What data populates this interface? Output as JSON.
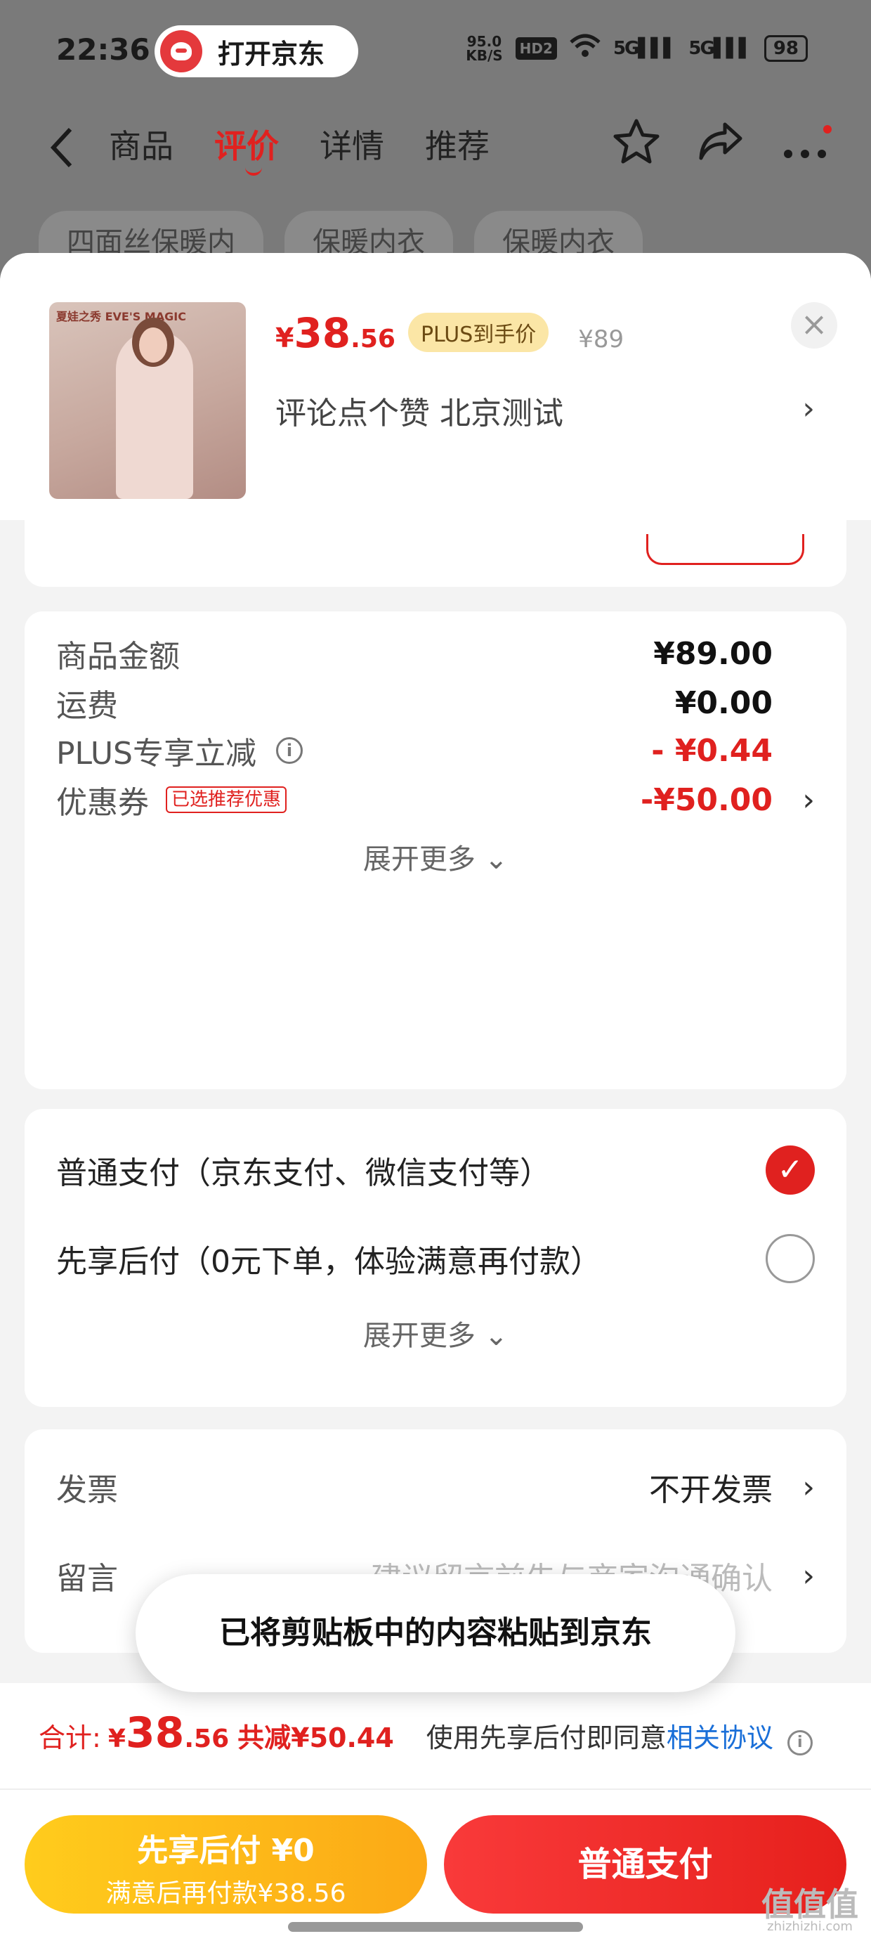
{
  "status_bar": {
    "time": "22:36",
    "open_app": "打开京东",
    "net_speed_value": "95.0",
    "net_speed_unit": "KB/S",
    "hd": "HD2",
    "signal_1": "5G",
    "signal_2": "5G",
    "battery": "98"
  },
  "nav": {
    "tabs": [
      "商品",
      "评价",
      "详情",
      "推荐"
    ],
    "active_tab": "评价"
  },
  "search_chips": [
    "四面丝保暖内",
    "保暖内衣",
    "保暖内衣"
  ],
  "product": {
    "brand": "夏娃之秀 EVE'S MAGIC",
    "price_symbol": "¥",
    "price_int": "38",
    "price_dec": ".56",
    "plus_badge": "PLUS到手价",
    "original_price": "¥89",
    "desc": "评论点个赞  北京测试"
  },
  "cost": {
    "rows": [
      {
        "label": "商品金额",
        "value": "¥89.00"
      },
      {
        "label": "运费",
        "value": "¥0.00"
      },
      {
        "label": "PLUS专享立减",
        "value": "- ¥0.44"
      },
      {
        "label": "优惠券",
        "value": "-¥50.00",
        "tag": "已选推荐优惠"
      }
    ],
    "expand": "展开更多"
  },
  "payment": {
    "options": [
      {
        "label": "普通支付（京东支付、微信支付等）",
        "checked": true
      },
      {
        "label": "先享后付（0元下单，体验满意再付款）",
        "checked": false
      }
    ],
    "expand": "展开更多"
  },
  "invoice": {
    "label": "发票",
    "value": "不开发票",
    "message_label": "留言",
    "message_placeholder": "建议留言前先与商家沟通确认"
  },
  "toast": "已将剪贴板中的内容粘贴到京东",
  "footer": {
    "total_label": "合计:",
    "total_symbol": "¥",
    "total_int": "38",
    "total_dec": ".56",
    "saving": "共减¥50.44",
    "agree_text": "使用先享后付即同意",
    "agree_link": "相关协议",
    "bnpl_title": "先享后付 ¥0",
    "bnpl_sub": "满意后再付款¥38.56",
    "normal_pay": "普通支付"
  },
  "watermark": {
    "main": "值值值",
    "sub": "zhizhizhi.com"
  },
  "colors": {
    "accent": "#e0211f",
    "bnpl": "#fcb51a",
    "link": "#1a6fd8"
  }
}
